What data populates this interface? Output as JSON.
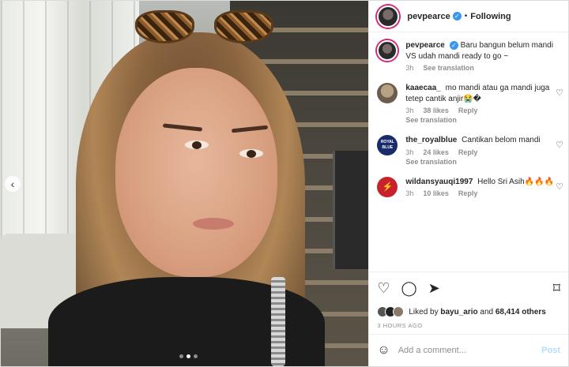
{
  "header": {
    "username": "pevpearce",
    "verified_mark": "✓",
    "separator": "•",
    "follow_label": "Following"
  },
  "caption": {
    "username": "pevpearce",
    "verified_mark": "✓",
    "text": "Baru bangun belum mandi VS udah mandi ready to go ~",
    "time": "3h",
    "see_translation": "See translation"
  },
  "comments": [
    {
      "username": "kaaecaa_",
      "text": "mo mandi atau ga mandi juga tetep cantik anjir😭�",
      "time": "3h",
      "likes": "38 likes",
      "reply": "Reply",
      "see_translation": "See translation"
    },
    {
      "username": "the_royalblue",
      "avatar_text": "ROYAL BLUE",
      "text": "Cantikan belom mandi",
      "time": "3h",
      "likes": "24 likes",
      "reply": "Reply",
      "see_translation": "See translation"
    },
    {
      "username": "wildansyauqi1997",
      "text": "Hello Sri Asih🔥🔥🔥",
      "time": "3h",
      "likes": "10 likes",
      "reply": "Reply"
    }
  ],
  "likes": {
    "prefix": "Liked by",
    "user": "bayu_ario",
    "joiner": "and",
    "others": "68,414 others"
  },
  "timestamp": "3 HOURS AGO",
  "add_comment": {
    "placeholder": "Add a comment...",
    "post_label": "Post"
  },
  "icons": {
    "like": "heart-icon",
    "comment": "comment-icon",
    "share": "share-icon",
    "save": "bookmark-icon",
    "emoji": "smiley-icon"
  },
  "carousel": {
    "slides": 3,
    "current": 1
  },
  "colors": {
    "verified": "#3897f0",
    "post_button": "#b2dffc",
    "muted": "#8e8e8e"
  }
}
